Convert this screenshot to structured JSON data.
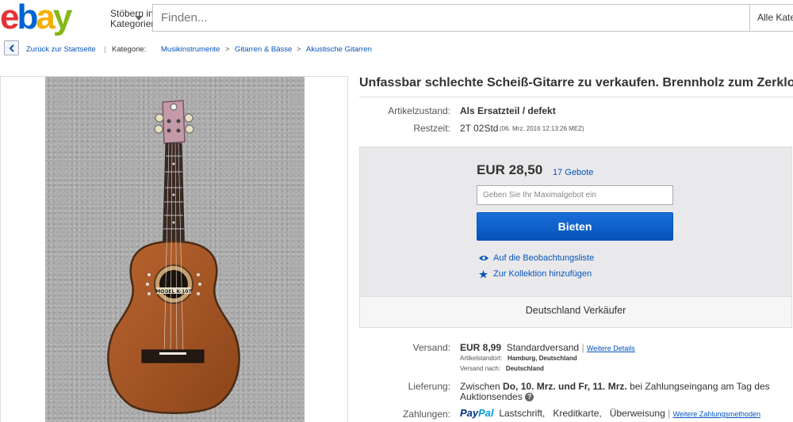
{
  "header": {
    "logo_letters": [
      "e",
      "b",
      "a",
      "y"
    ],
    "logo_colors": [
      "#e53238",
      "#0064d2",
      "#f5af02",
      "#86b817"
    ],
    "browse_line1": "Stöbern in",
    "browse_line2": "Kategorien",
    "search_placeholder": "Finden...",
    "category_select": "Alle Kate"
  },
  "breadcrumb": {
    "back": "Zurück zur Startseite",
    "category_label": "Kategorie:",
    "items": [
      "Musikinstrumente",
      "Gitarren & Bässe",
      "Akustische Gitarren"
    ],
    "separator": ">"
  },
  "listing": {
    "title": "Unfassbar schlechte Scheiß-Gitarre zu verkaufen. Brennholz zum Zerklop",
    "condition_label": "Artikelzustand:",
    "condition_value": "Als Ersatzteil / defekt",
    "time_label": "Restzeit:",
    "time_value": "2T 02Std",
    "time_end": "(06. Mrz. 2016   12:13:26 MEZ)",
    "image_label": "MODEL K-107"
  },
  "bid": {
    "price": "EUR 28,50",
    "bids": "17 Gebote",
    "input_placeholder": "Geben Sie Ihr Maximalgebot ein",
    "button": "Bieten",
    "watchlist": "Auf die Beobachtungsliste",
    "collection": "Zur Kollektion hinzufügen",
    "seller_location": "Deutschland Verkäufer"
  },
  "shipping": {
    "label": "Versand:",
    "price": "EUR 8,99",
    "method": "Standardversand",
    "separator": "|",
    "details_link": "Weitere Details",
    "location_label": "Artikelstandort:",
    "location_value": "Hamburg, Deutschland",
    "ships_to_label": "Versand nach:",
    "ships_to_value": "Deutschland"
  },
  "delivery": {
    "label": "Lieferung:",
    "prefix": "Zwischen",
    "range": "Do, 10. Mrz. und Fr, 11. Mrz.",
    "suffix": "bei Zahlungseingang am Tag des",
    "line2": "Auktionsendes",
    "help": "?"
  },
  "payments": {
    "label": "Zahlungen:",
    "paypal_a": "Pay",
    "paypal_b": "Pal",
    "methods": "Lastschrift,   Kreditkarte,   Überweisung",
    "separator": "|",
    "more_link": "Weitere Zahlungsmethoden"
  }
}
